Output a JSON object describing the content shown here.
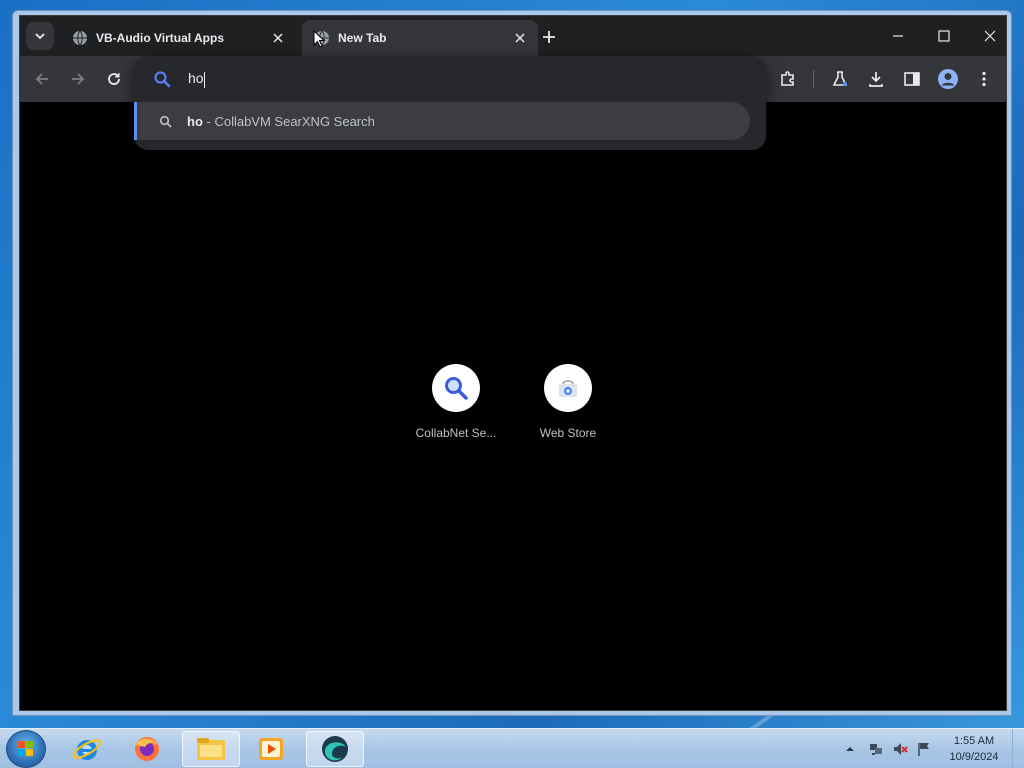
{
  "tabs": [
    {
      "title": "VB-Audio Virtual Apps",
      "active": false
    },
    {
      "title": "New Tab",
      "active": true
    }
  ],
  "omnibox": {
    "value": "ho",
    "suggestion": {
      "query": "ho",
      "separator": " - ",
      "engine": "CollabVM SearXNG Search"
    }
  },
  "shortcuts": [
    {
      "label": "CollabNet Se...",
      "icon": "search-icon"
    },
    {
      "label": "Web Store",
      "icon": "web-store-icon"
    }
  ],
  "taskbar": {
    "apps": [
      "internet-explorer-icon",
      "firefox-icon",
      "file-explorer-icon",
      "media-player-icon",
      "browser-icon"
    ]
  },
  "clock": {
    "time": "1:55 AM",
    "date": "10/9/2024"
  },
  "colors": {
    "accent": "#5b8ff5",
    "toolbar": "#35363a",
    "tabstrip": "#1f2022",
    "content": "#000000"
  }
}
